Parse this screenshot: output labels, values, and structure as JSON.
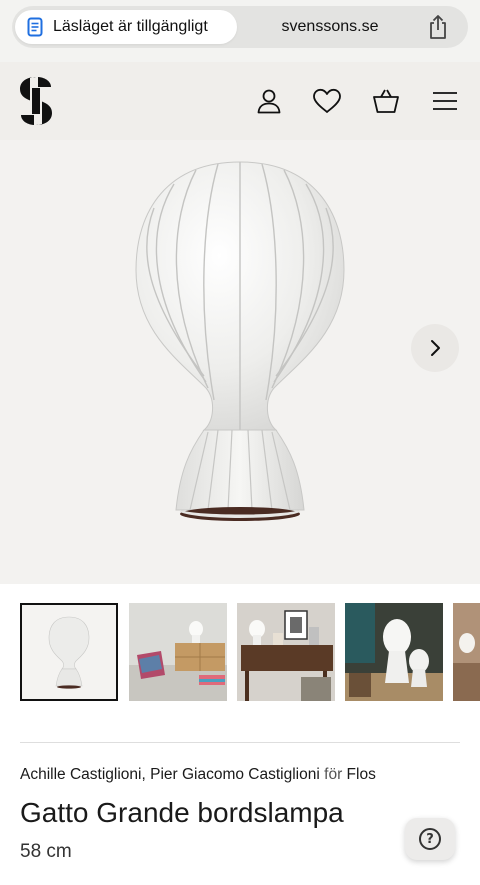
{
  "browser": {
    "reader_label": "Läsläget är tillgängligt",
    "url": "svenssons.se"
  },
  "header": {
    "logo": "S",
    "icons": [
      "account-icon",
      "wishlist-icon",
      "cart-icon",
      "menu-icon"
    ]
  },
  "gallery": {
    "thumbnails": [
      {
        "name": "thumbnail-product",
        "active": true
      },
      {
        "name": "thumbnail-sideboard-scene",
        "active": false
      },
      {
        "name": "thumbnail-desk-scene",
        "active": false
      },
      {
        "name": "thumbnail-floor-lamps",
        "active": false
      },
      {
        "name": "thumbnail-dining-scene",
        "active": false
      }
    ]
  },
  "product": {
    "designer_1": "Achille Castiglioni",
    "designer_sep": ",",
    "designer_2": "Pier Giacomo Castiglioni",
    "for_label": "för",
    "brand": "Flos",
    "title": "Gatto Grande bordslampa",
    "size": "58 cm"
  },
  "help": {
    "icon": "?"
  }
}
